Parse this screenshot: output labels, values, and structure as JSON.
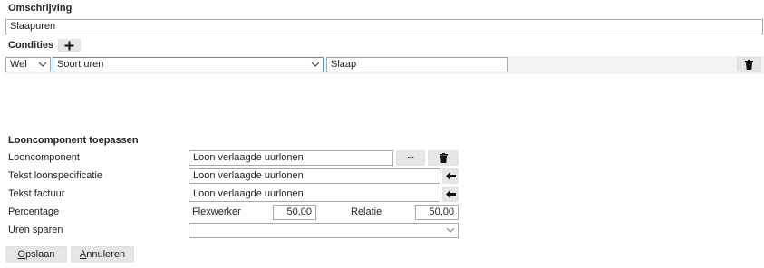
{
  "omschrijving": {
    "label": "Omschrijving",
    "value": "Slaapuren"
  },
  "condities": {
    "label": "Condities",
    "add_icon": "plus-icon",
    "row": {
      "operator": "Wel",
      "field": "Soort uren",
      "value": "Slaap",
      "delete_icon": "trash-icon"
    }
  },
  "looncomponent_section": {
    "title": "Looncomponent toepassen",
    "looncomponent": {
      "label": "Looncomponent",
      "value": "Loon verlaagde uurlonen",
      "more_label": "···",
      "delete_icon": "trash-icon"
    },
    "tekst_loonspecificatie": {
      "label": "Tekst loonspecificatie",
      "value": "Loon verlaagde uurlonen",
      "action_icon": "arrow-left-icon"
    },
    "tekst_factuur": {
      "label": "Tekst factuur",
      "value": "Loon verlaagde uurlonen",
      "action_icon": "arrow-left-icon"
    },
    "percentage": {
      "label": "Percentage",
      "flexwerker_label": "Flexwerker",
      "flexwerker_value": "50,00",
      "relatie_label": "Relatie",
      "relatie_value": "50,00"
    },
    "uren_sparen": {
      "label": "Uren sparen",
      "value": ""
    }
  },
  "footer": {
    "save": {
      "prefix": "",
      "accel": "O",
      "rest": "pslaan"
    },
    "cancel": {
      "prefix": "",
      "accel": "A",
      "rest": "nnuleren"
    }
  }
}
